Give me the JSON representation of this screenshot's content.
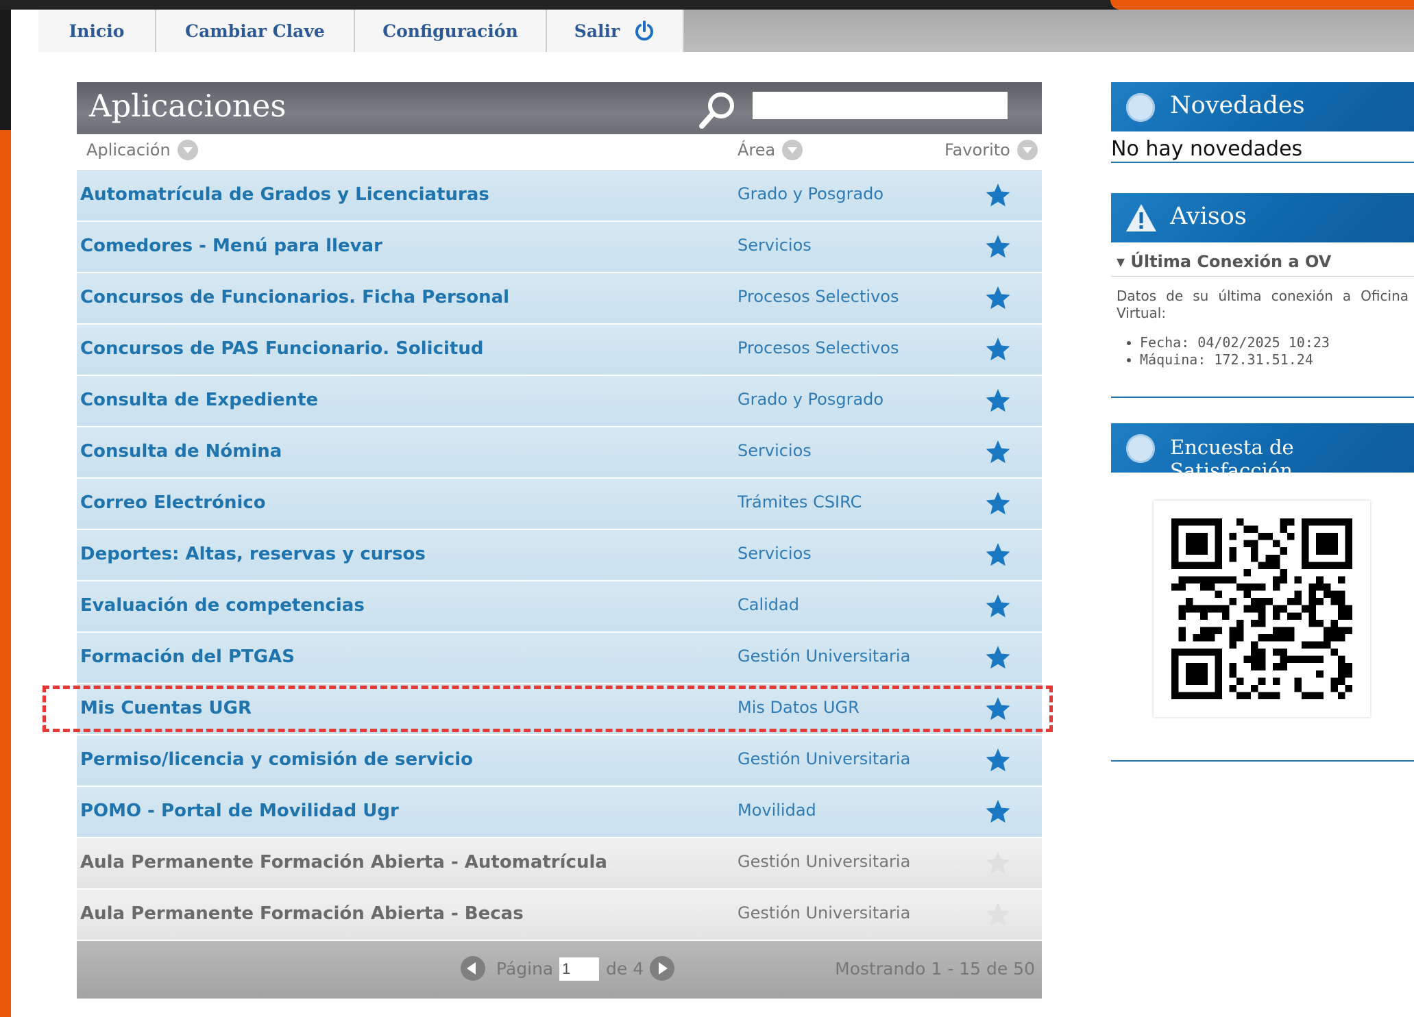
{
  "nav": {
    "tabs": [
      "Inicio",
      "Cambiar Clave",
      "Configuración",
      "Salir"
    ]
  },
  "apps": {
    "title": "Aplicaciones",
    "search_value": "",
    "columns": {
      "app": "Aplicación",
      "area": "Área",
      "fav": "Favorito"
    },
    "rows": [
      {
        "name": "Automatrícula de Grados y Licenciaturas",
        "area": "Grado y Posgrado",
        "favorite": true
      },
      {
        "name": "Comedores - Menú para llevar",
        "area": "Servicios",
        "favorite": true
      },
      {
        "name": "Concursos de Funcionarios. Ficha Personal",
        "area": "Procesos Selectivos",
        "favorite": true
      },
      {
        "name": "Concursos de PAS Funcionario. Solicitud",
        "area": "Procesos Selectivos",
        "favorite": true
      },
      {
        "name": "Consulta de Expediente",
        "area": "Grado y Posgrado",
        "favorite": true
      },
      {
        "name": "Consulta de Nómina",
        "area": "Servicios",
        "favorite": true
      },
      {
        "name": "Correo Electrónico",
        "area": "Trámites CSIRC",
        "favorite": true
      },
      {
        "name": "Deportes: Altas, reservas y cursos",
        "area": "Servicios",
        "favorite": true
      },
      {
        "name": "Evaluación de competencias",
        "area": "Calidad",
        "favorite": true
      },
      {
        "name": "Formación del PTGAS",
        "area": "Gestión Universitaria",
        "favorite": true
      },
      {
        "name": "Mis Cuentas UGR",
        "area": "Mis Datos UGR",
        "favorite": true
      },
      {
        "name": "Permiso/licencia y comisión de servicio",
        "area": "Gestión Universitaria",
        "favorite": true
      },
      {
        "name": "POMO - Portal de Movilidad Ugr",
        "area": "Movilidad",
        "favorite": true
      },
      {
        "name": "Aula Permanente Formación Abierta - Automatrícula",
        "area": "Gestión Universitaria",
        "favorite": false
      },
      {
        "name": "Aula Permanente Formación Abierta - Becas",
        "area": "Gestión Universitaria",
        "favorite": false
      }
    ],
    "pager": {
      "page_label": "Página",
      "page_value": "1",
      "of_label": "de 4",
      "showing": "Mostrando 1 - 15 de 50"
    }
  },
  "sidebar": {
    "novedades": {
      "title": "Novedades",
      "text": "No hay novedades"
    },
    "avisos": {
      "title": "Avisos",
      "subtitle": "Última Conexión a OV",
      "intro": "Datos de su última conexión a Oficina Virtual:",
      "fecha": "Fecha: 04/02/2025 10:23",
      "maquina": "Máquina: 172.31.51.24"
    },
    "encuesta": {
      "title": "Encuesta de Satisfacción"
    }
  },
  "colors": {
    "link": "#1f74ad",
    "star_on": "#1a78c2",
    "star_off": "#e0e0e0",
    "header_blue": "#1068ad",
    "highlight": "#e53935"
  },
  "icons": [
    "search-icon",
    "power-icon",
    "star-icon",
    "warning-icon",
    "qr-code"
  ]
}
